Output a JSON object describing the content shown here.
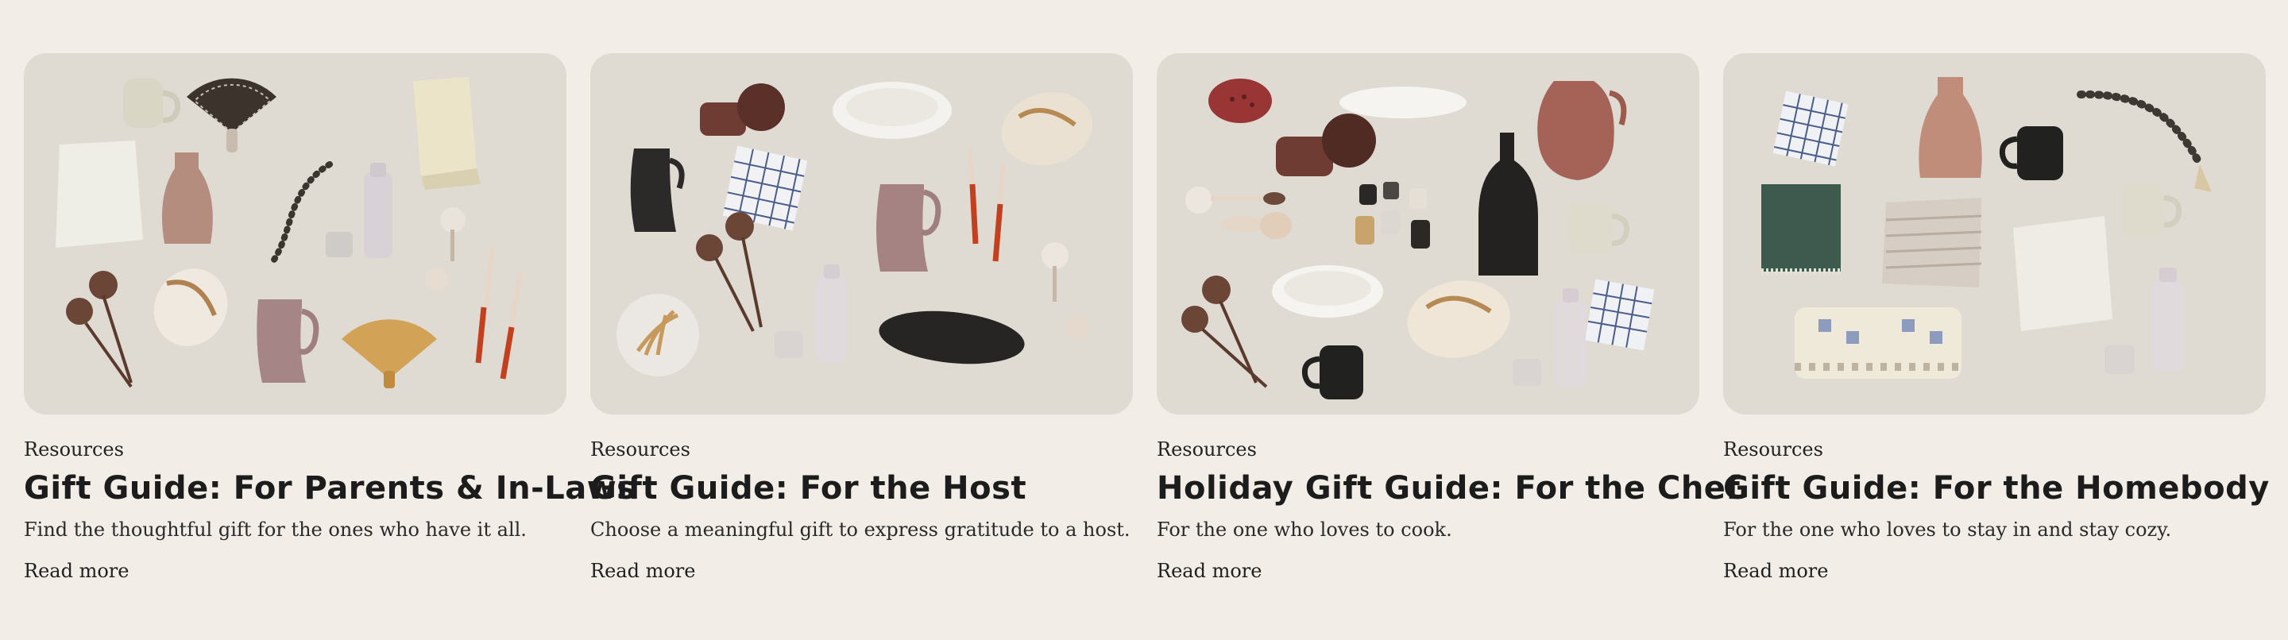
{
  "cards": [
    {
      "category": "Resources",
      "title": "Gift Guide: For Parents & In-Laws",
      "description": "Find the thoughtful gift for the ones who have it all.",
      "read_more": "Read more"
    },
    {
      "category": "Resources",
      "title": "Gift Guide: For the Host",
      "description": "Choose a meaningful gift to express gratitude to a host.",
      "read_more": "Read more"
    },
    {
      "category": "Resources",
      "title": "Holiday Gift Guide: For the Chef",
      "description": "For the one who loves to cook.",
      "read_more": "Read more"
    },
    {
      "category": "Resources",
      "title": "Gift Guide: For the Homebody",
      "description": "For the one who loves to stay in and stay cozy.",
      "read_more": "Read more"
    }
  ]
}
